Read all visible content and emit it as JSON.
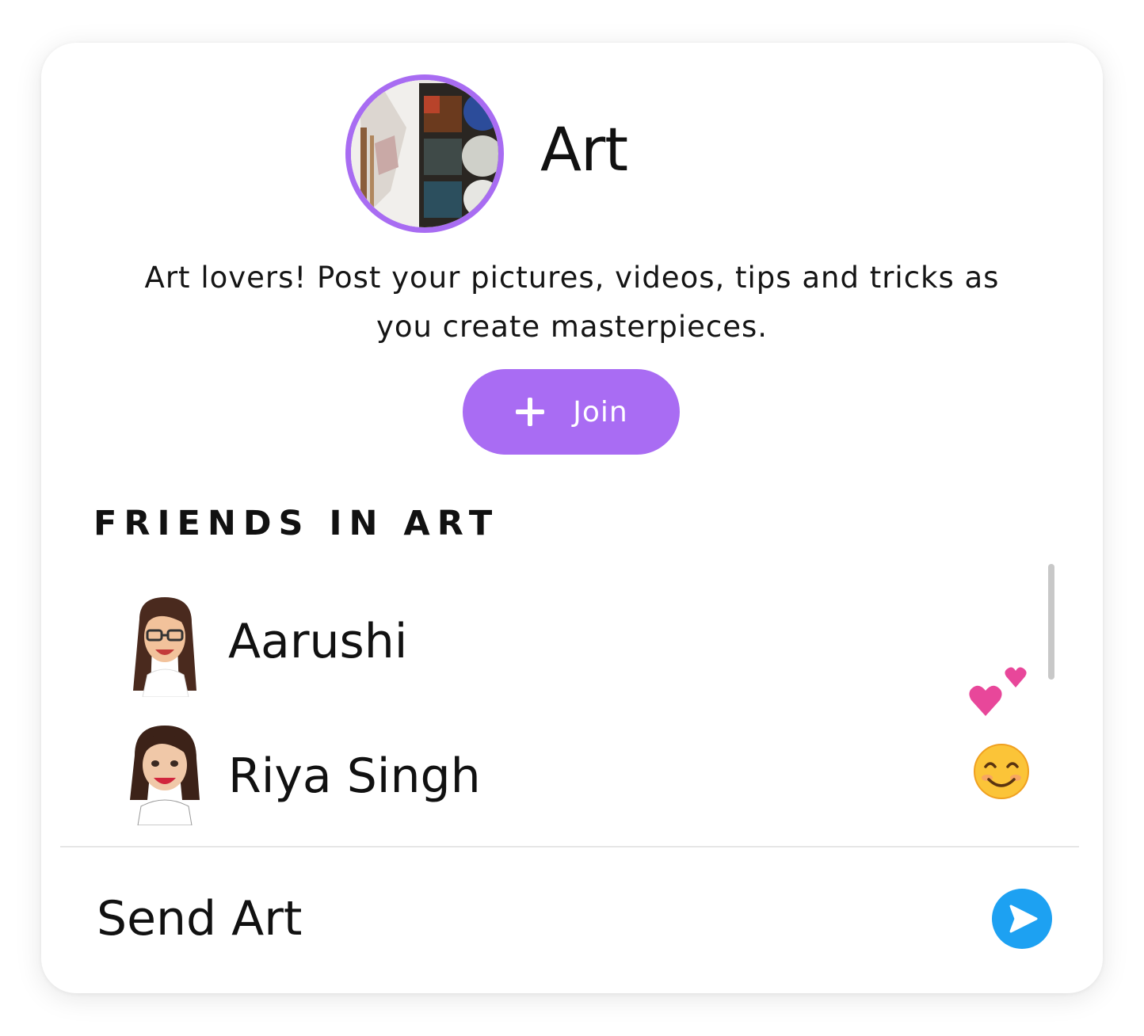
{
  "group": {
    "title": "Art",
    "description": "Art lovers! Post your pictures, videos, tips and tricks as you create masterpieces.",
    "join_label": "Join",
    "accent_color": "#a86cf2"
  },
  "friends_section": {
    "title": "FRIENDS IN ART",
    "friends": [
      {
        "name": "Aarushi",
        "emoji": "two-hearts"
      },
      {
        "name": "Riya Singh",
        "emoji": "smiling-face"
      }
    ]
  },
  "send": {
    "label": "Send Art",
    "icon": "send-arrow-icon",
    "icon_color": "#1da1f2"
  }
}
